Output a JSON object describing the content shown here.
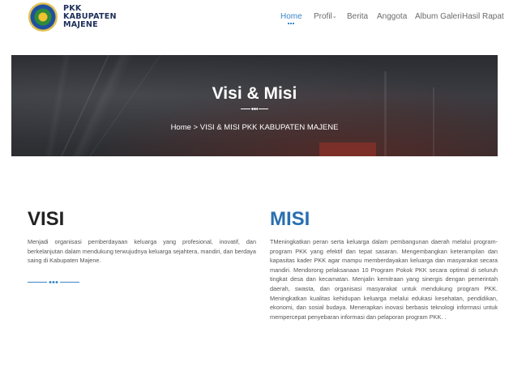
{
  "header": {
    "logo_lines": [
      "PKK",
      "KABUPATEN",
      "MAJENE"
    ],
    "nav": [
      {
        "label": "Home",
        "active": true
      },
      {
        "label": "Profil",
        "dropdown": true
      },
      {
        "label": "Berita"
      },
      {
        "label": "Anggota"
      },
      {
        "label": "Album Galeri"
      },
      {
        "label": "Hasil Rapat"
      }
    ]
  },
  "banner": {
    "title": "Visi & Misi",
    "breadcrumb": "Home  >  VISI & MISI PKK KABUPATEN MAJENE"
  },
  "visi": {
    "title": "VISI",
    "text": "Menjadi organisasi pemberdayaan keluarga yang profesional, inovatif, dan berkelanjutan dalam mendukung terwujudnya keluarga sejahtera, mandiri, dan berdaya saing di Kabupaten Majene."
  },
  "misi": {
    "title": "MISI",
    "text": "TMeningkatkan peran serta keluarga dalam pembangunan daerah melalui program-program PKK yang efektif dan tepat sasaran. Mengembangkan keterampilan dan kapasitas kader PKK agar mampu memberdayakan keluarga dan masyarakat secara mandiri. Mendorong pelaksanaan 10 Program Pokok PKK secara optimal di seluruh tingkat desa dan kecamatan. Menjalin kemitraan yang sinergis dengan pemerintah daerah, swasta, dan organisasi masyarakat untuk mendukung program PKK. Meningkatkan kualitas kehidupan keluarga melalui edukasi kesehatan, pendidikan, ekonomi, dan sosial budaya. Menerapkan inovasi berbasis teknologi informasi untuk mempercepat penyebaran informasi dan pelaporan program PKK. ."
  },
  "colors": {
    "accent": "#3a86c8",
    "misi_title": "#2a6fb0",
    "text": "#555555"
  }
}
